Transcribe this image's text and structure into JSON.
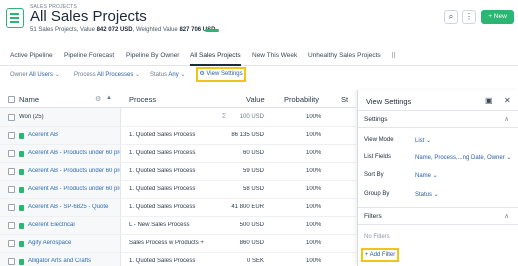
{
  "header": {
    "section_label": "SALES PROJECTS",
    "title": "All Sales Projects",
    "title_chevron": "⌄",
    "summary_prefix": "51 Sales Projects, Value ",
    "summary_value": "842 072 USD",
    "summary_mid": ", Weighted Value ",
    "summary_weighted": "827 706 USD",
    "search_icon": "⌕",
    "more_icon": "⋮",
    "new_button": "+ New"
  },
  "tabs": [
    {
      "label": "Active Pipeline",
      "active": false
    },
    {
      "label": "Pipeline Forecast",
      "active": false
    },
    {
      "label": "Pipeline By Owner",
      "active": false
    },
    {
      "label": "All Sales Projects",
      "active": true
    },
    {
      "label": "New This Week",
      "active": false
    },
    {
      "label": "Unhealthy Sales Projects",
      "active": false
    }
  ],
  "tab_more_icon": "⠿",
  "filters": {
    "owner_label": "Owner",
    "owner_value": "All Users",
    "process_label": "Process",
    "process_value": "All Processes",
    "status_label": "Status",
    "status_value": "Any",
    "view_settings": "View Settings"
  },
  "table": {
    "headers": {
      "name": "Name",
      "process": "Process",
      "value": "Value",
      "probability": "Probability",
      "status": "St"
    },
    "group": {
      "label": "Won (25)",
      "sigma": "Σ",
      "value": "100 USD",
      "probability": "100%"
    },
    "rows": [
      {
        "name": "Acerent AB",
        "process": "1. Quoted Sales Process",
        "value": "86 135 USD",
        "probability": "100%"
      },
      {
        "name": "Acerent AB - Products under 60 prof",
        "process": "1. Quoted Sales Process",
        "value": "60 USD",
        "probability": "100%"
      },
      {
        "name": "Acerent AB - Products under 60 prof",
        "process": "1. Quoted Sales Process",
        "value": "59 USD",
        "probability": "100%"
      },
      {
        "name": "Acerent AB - Products under 60 prof",
        "process": "1. Quoted Sales Process",
        "value": "58 USD",
        "probability": "100%"
      },
      {
        "name": "Acerent AB - SP-6825 - Quote",
        "process": "1. Quoted Sales Process",
        "value": "41 800 EUR",
        "probability": "100%"
      },
      {
        "name": "Acerent Electrical",
        "process": "L - New Sales Process",
        "value": "500 USD",
        "probability": "100%"
      },
      {
        "name": "Agify Aerospace",
        "process": "Sales Process w Products +",
        "value": "860 USD",
        "probability": "100%"
      },
      {
        "name": "Alligator Arts and Crafts",
        "process": "1. Quoted Sales Process",
        "value": "0 SEK",
        "probability": "100%"
      }
    ]
  },
  "panel": {
    "title": "View Settings",
    "settings_section": "Settings",
    "settings": [
      {
        "label": "View Mode",
        "value": "List ⌄"
      },
      {
        "label": "List Fields",
        "value": "Name, Process,...ng Date, Owner ⌄"
      },
      {
        "label": "Sort By",
        "value": "Name ⌄"
      },
      {
        "label": "Group By",
        "value": "Status ⌄"
      }
    ],
    "filters_section": "Filters",
    "no_filters": "No Filters",
    "add_filter": "+ Add Filter"
  }
}
